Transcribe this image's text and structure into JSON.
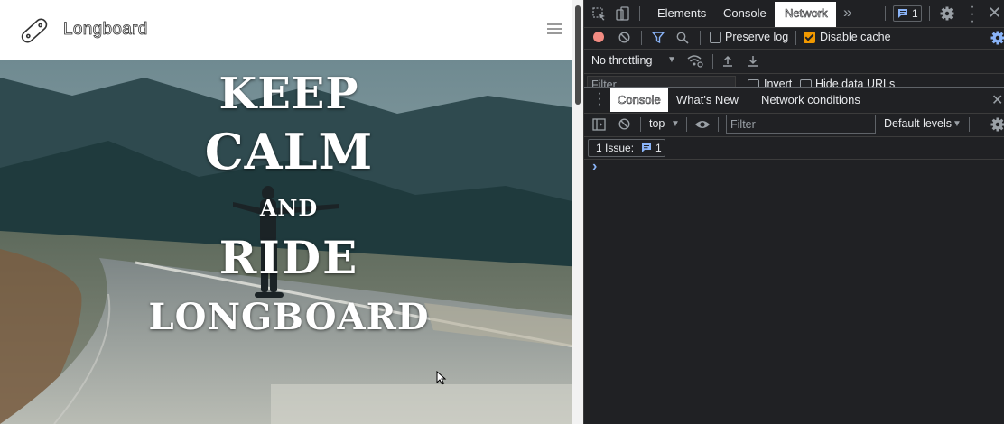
{
  "site": {
    "title": "Longboard",
    "hero": {
      "line1": "KEEP",
      "line2": "CALM",
      "line3": "AND",
      "line4": "RIDE",
      "line5": "LONGBOARD"
    },
    "logo_icon": "skateboard-icon",
    "menu_icon": "hamburger-menu-icon"
  },
  "devtools": {
    "tabs": [
      "Elements",
      "Console",
      "Network"
    ],
    "active_tab": "Network",
    "more_tabs_icon": "double-chevron-icon",
    "issues_badge_count": "1",
    "network": {
      "preserve_log_label": "Preserve log",
      "preserve_log_checked": false,
      "disable_cache_label": "Disable cache",
      "disable_cache_checked": true,
      "throttling_value": "No throttling",
      "filter_placeholder": "Filter",
      "invert_label": "Invert",
      "hide_data_urls_label": "Hide data URLs"
    },
    "drawer": {
      "tabs": [
        "Console",
        "What's New",
        "Network conditions"
      ],
      "active_tab": "Console"
    },
    "console": {
      "context_value": "top",
      "filter_placeholder": "Filter",
      "levels_value": "Default levels",
      "issues_label": "1 Issue:",
      "issues_count": "1",
      "prompt_symbol": "›"
    },
    "colors": {
      "background": "#202124",
      "accent_blue": "#8ab4f8",
      "record_red": "#f28b82",
      "checkbox_orange": "#f29900"
    }
  }
}
